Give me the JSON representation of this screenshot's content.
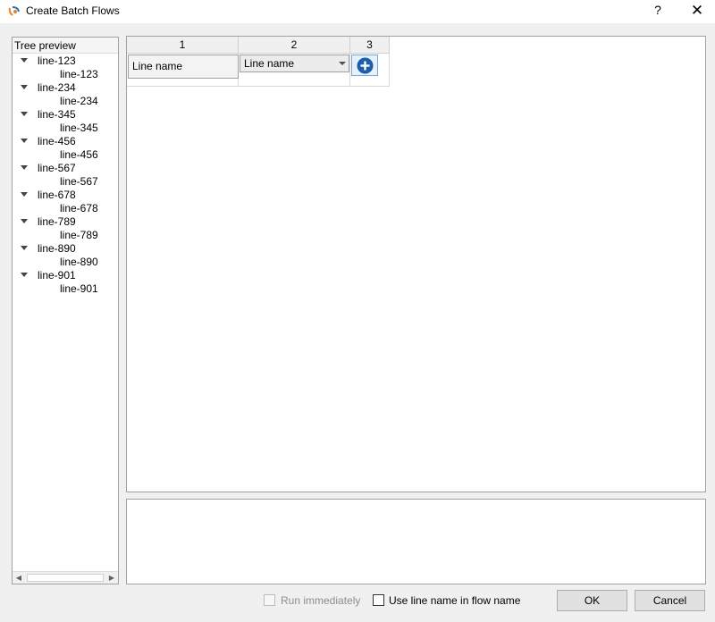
{
  "window": {
    "title": "Create Batch Flows",
    "help_label": "?",
    "close_label": "✕"
  },
  "tree": {
    "header": "Tree preview",
    "nodes": [
      {
        "label": "line-123",
        "child": "line-123"
      },
      {
        "label": "line-234",
        "child": "line-234"
      },
      {
        "label": "line-345",
        "child": "line-345"
      },
      {
        "label": "line-456",
        "child": "line-456"
      },
      {
        "label": "line-567",
        "child": "line-567"
      },
      {
        "label": "line-678",
        "child": "line-678"
      },
      {
        "label": "line-789",
        "child": "line-789"
      },
      {
        "label": "line-890",
        "child": "line-890"
      },
      {
        "label": "line-901",
        "child": "line-901"
      }
    ],
    "scroll_left": "◀",
    "scroll_right": "▶"
  },
  "grid": {
    "columns": [
      "1",
      "2",
      "3"
    ],
    "col1_value": "Line name",
    "col2_selected": "Line name"
  },
  "footer": {
    "run_immediately": "Run immediately",
    "run_immediately_checked": false,
    "use_line_name": "Use line name in flow name",
    "use_line_name_checked": false,
    "ok": "OK",
    "cancel": "Cancel"
  },
  "colors": {
    "add_button_fill": "#1a5fa8",
    "accent_border": "#7aa7d6"
  },
  "icons": {
    "app": "app-logo-icon",
    "add": "plus-circle-icon",
    "tree_expand": "triangle-down-icon"
  }
}
